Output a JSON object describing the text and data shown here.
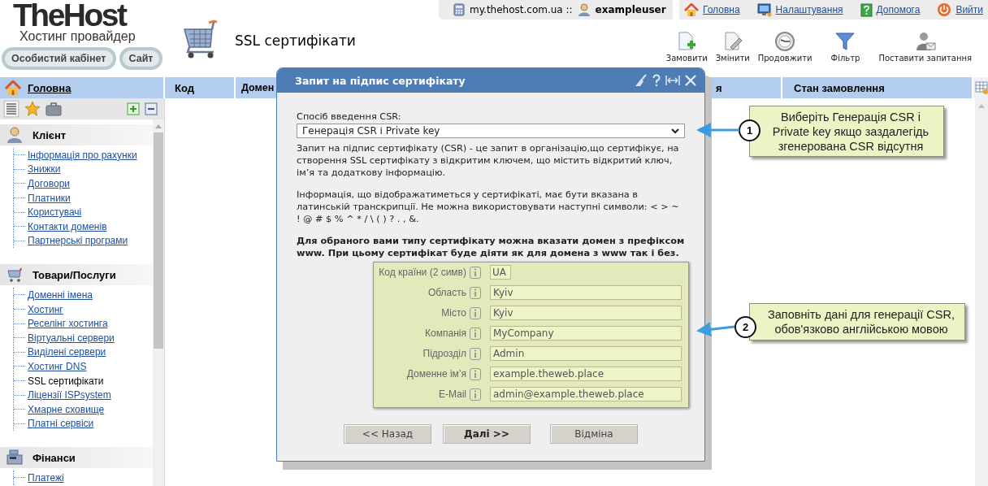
{
  "logo": {
    "name": "TheHost",
    "tagline": "Хостинг провайдер"
  },
  "header_buttons": [
    "Особистий кабінет",
    "Сайт"
  ],
  "page_title": "SSL сертифікати",
  "account_bar": {
    "host": "my.thehost.com.ua ::",
    "user": "exampleuser"
  },
  "top_links": [
    {
      "kind": "home",
      "label": "Головна"
    },
    {
      "kind": "settings",
      "label": "Налаштування"
    },
    {
      "kind": "help",
      "label": "Допомога"
    },
    {
      "kind": "logout",
      "label": "Вийти"
    }
  ],
  "toolbar": [
    {
      "kind": "order",
      "label": "Замовити"
    },
    {
      "kind": "edit",
      "label": "Змінити"
    },
    {
      "kind": "renew",
      "label": "Продовжити"
    },
    {
      "kind": "filter",
      "label": "Фільтр"
    },
    {
      "kind": "ask",
      "label": "Поставити запитання"
    }
  ],
  "sidebar": {
    "home": "Головна",
    "sections": [
      {
        "kind": "client",
        "title": "Клієнт",
        "items": [
          {
            "label": "Інформація про рахунки",
            "selected": false
          },
          {
            "label": "Знижки",
            "selected": false
          },
          {
            "label": "Договори",
            "selected": false
          },
          {
            "label": "Платники",
            "selected": false
          },
          {
            "label": "Користувачі",
            "selected": false
          },
          {
            "label": "Контакти доменів",
            "selected": false
          },
          {
            "label": "Партнерські програми",
            "selected": false
          }
        ]
      },
      {
        "kind": "products",
        "title": "Товари/Послуги",
        "items": [
          {
            "label": "Доменні імена",
            "selected": false
          },
          {
            "label": "Хостинг",
            "selected": false
          },
          {
            "label": "Реселінг хостинга",
            "selected": false
          },
          {
            "label": "Віртуальні сервери",
            "selected": false
          },
          {
            "label": "Виділені сервери",
            "selected": false
          },
          {
            "label": "Хостинг DNS",
            "selected": false
          },
          {
            "label": "SSL сертифікати",
            "selected": true
          },
          {
            "label": "Ліцензії ISPsystem",
            "selected": false
          },
          {
            "label": "Хмарне сховище",
            "selected": false
          },
          {
            "label": "Платні сервіси",
            "selected": false
          }
        ]
      },
      {
        "kind": "finance",
        "title": "Фінанси",
        "items": [
          {
            "label": "Платежі",
            "selected": false
          }
        ]
      }
    ]
  },
  "table": {
    "columns": [
      "Код",
      "Домен",
      "я",
      "Стан замовлення"
    ]
  },
  "dialog": {
    "title": "Запит на підпис сертифікату",
    "csr_label": "Спосіб введення CSR:",
    "csr_method": "Генерація CSR і Private key",
    "description": [
      "Запит на підпис сертифікату (CSR) - це запит в організацію,що сертифікує, на створення SSL сертифікату з відкритим ключем, що містить відкритий ключ, ім’я та додаткову інформацію.",
      "Інформація, що відображатиметься у сертифікаті, має бути вказана в латинській транскрипції. Не можна використовувати наступні символи: < > ~ ! @ # $ % ^ * / \\ ( ) ? . , &."
    ],
    "note": "Для обраного вами типу сертифікату можна вказати домен з префіксом www. При цьому сертифікат буде діяти як для домена з www так і без.",
    "fields": [
      {
        "label": "Код країни (2 симв)",
        "value": "UA",
        "kind": "short"
      },
      {
        "label": "Область",
        "value": "Kyiv",
        "kind": "wide"
      },
      {
        "label": "Місто",
        "value": "Kyiv",
        "kind": "wide"
      },
      {
        "label": "Компанія",
        "value": "MyCompany",
        "kind": "wide"
      },
      {
        "label": "Підрозділ",
        "value": "Admin",
        "kind": "wide"
      },
      {
        "label": "Доменне ім’я",
        "value": "example.theweb.place",
        "kind": "wide"
      },
      {
        "label": "E-Mail",
        "value": "admin@example.theweb.place",
        "kind": "wide"
      }
    ],
    "buttons": [
      {
        "label": "<< Назад",
        "primary": false
      },
      {
        "label": "Далі >>",
        "primary": true
      },
      {
        "label": "Відміна",
        "primary": false
      }
    ]
  },
  "callouts": [
    {
      "number": "1",
      "text": "Виберіть Генерація CSR і Private key якщо заздалегідь згенерована CSR відсутня"
    },
    {
      "number": "2",
      "text": "Заповніть дані для генерації CSR, обов'язково англійською мовою"
    }
  ]
}
